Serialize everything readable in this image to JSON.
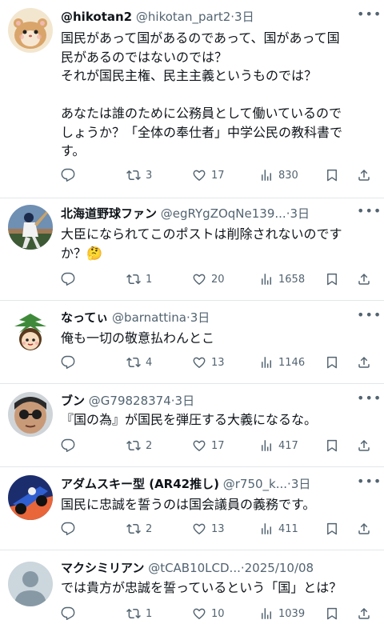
{
  "colors": {
    "text": "#0f1419",
    "muted": "#536471",
    "separator": "#e3e6e8"
  },
  "tweets": [
    {
      "name": "@hikotan2",
      "handle": "@hikotan_part2",
      "meta": "·3日",
      "text": "国民があって国があるのであって、国があって国\n民があるのではないのでは？\nそれが国民主権、民主主義というものでは？\n\nあなたは誰のために公務員として働いているので\nしょうか？「全体の奉仕者」中学公民の教科書で\nす。",
      "replies": "",
      "retweets": "3",
      "likes": "17",
      "views": "830",
      "avatar_icon": "hamster-avatar-icon"
    },
    {
      "name": "北海道野球ファン",
      "handle": "@egRYgZOqNe139...",
      "meta": "·3日",
      "text": "大臣になられてこのポストは削除されないのです\nか？🤔",
      "replies": "",
      "retweets": "1",
      "likes": "20",
      "views": "1658",
      "avatar_icon": "baseball-player-avatar-icon"
    },
    {
      "name": "なってぃ",
      "handle": "@barnattina",
      "meta": "·3日",
      "text": "俺も一切の敬意払わんとこ",
      "replies": "",
      "retweets": "4",
      "likes": "13",
      "views": "1146",
      "avatar_icon": "palm-character-avatar-icon"
    },
    {
      "name": "ブン",
      "handle": "@G79828374",
      "meta": "·3日",
      "text": "『国の為』が国民を弾圧する大義になるな。",
      "replies": "",
      "retweets": "2",
      "likes": "17",
      "views": "417",
      "avatar_icon": "person-sunglasses-avatar-icon"
    },
    {
      "name": "アダムスキー型 (AR42推し)",
      "handle": "@r750_k...",
      "meta": "·3日",
      "text": "国民に忠誠を誓うのは国会議員の義務です。",
      "replies": "",
      "retweets": "2",
      "likes": "13",
      "views": "411",
      "avatar_icon": "racing-avatar-icon"
    },
    {
      "name": "マクシミリアン",
      "handle": "@tCAB10LCD...",
      "meta": "·2025/10/08",
      "text": "では貴方が忠誠を誓っているという「国」とは？",
      "replies": "",
      "retweets": "1",
      "likes": "10",
      "views": "1039",
      "avatar_icon": "default-avatar-icon"
    }
  ]
}
